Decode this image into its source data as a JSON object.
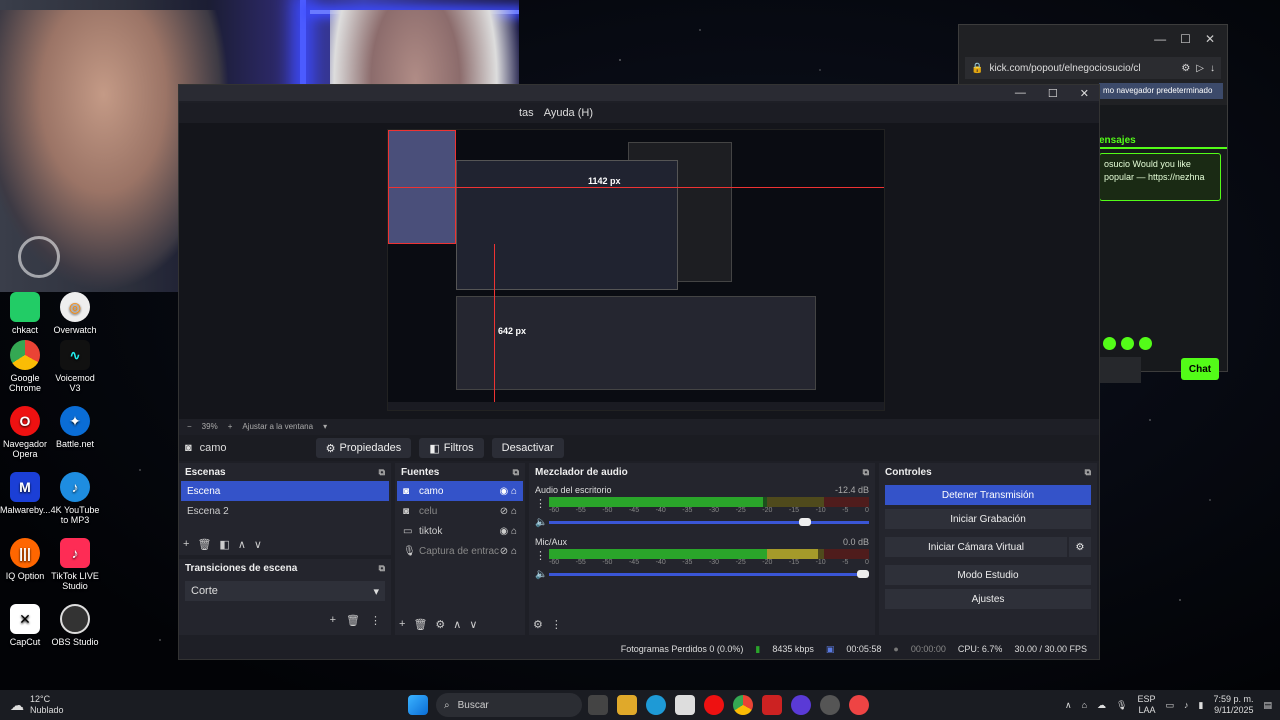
{
  "desktop_icons": [
    {
      "label": "chkact"
    },
    {
      "label": "Overwatch"
    },
    {
      "label": "Google Chrome"
    },
    {
      "label": "Voicemod V3"
    },
    {
      "label": "Navegador Opera"
    },
    {
      "label": "Battle.net"
    },
    {
      "label": "Malwareby..."
    },
    {
      "label": "4K YouTube to MP3"
    },
    {
      "label": "IQ Option"
    },
    {
      "label": "TikTok LIVE Studio"
    },
    {
      "label": "CapCut"
    },
    {
      "label": "OBS Studio"
    }
  ],
  "browser": {
    "url": "kick.com/popout/elnegociosucio/cl",
    "notice": "mo navegador predeterminado",
    "messages_label": "ensajes",
    "message": "osucio Would you like popular — https://nezhna",
    "chat_button": "Chat"
  },
  "obs": {
    "menu": [
      "tas",
      "Ayuda (H)"
    ],
    "preview": {
      "label_h": "1142 px",
      "label_v": "642 px"
    },
    "zoom": {
      "minus": "−",
      "value": "39%",
      "plus": "+",
      "fit": "Ajustar a la ventana"
    },
    "source_bar": {
      "name": "camo",
      "properties": "Propiedades",
      "filters": "Filtros",
      "deactivate": "Desactivar"
    },
    "scenes": {
      "title": "Escenas",
      "items": [
        "Escena",
        "Escena 2"
      ]
    },
    "transitions": {
      "title": "Transiciones de escena",
      "selected": "Corte"
    },
    "sources": {
      "title": "Fuentes",
      "items": [
        "camo",
        "celu",
        "tiktok",
        "Captura de entrac"
      ]
    },
    "mixer": {
      "title": "Mezclador de audio",
      "channels": [
        {
          "name": "Audio del escritorio",
          "db": "-12.4 dB",
          "level": 0.67,
          "volume": 0.82
        },
        {
          "name": "Mic/Aux",
          "db": "0.0 dB",
          "level": 0.84,
          "volume": 1.0
        }
      ],
      "scale": [
        "-60",
        "-55",
        "-50",
        "-45",
        "-40",
        "-35",
        "-30",
        "-25",
        "-20",
        "-15",
        "-10",
        "-5",
        "0"
      ]
    },
    "controls": {
      "title": "Controles",
      "stop_stream": "Detener Transmisión",
      "start_recording": "Iniciar Grabación",
      "virtual_cam": "Iniciar Cámara Virtual",
      "studio_mode": "Modo Estudio",
      "settings": "Ajustes"
    },
    "status": {
      "dropped": "Fotogramas Perdidos 0 (0.0%)",
      "bitrate": "8435 kbps",
      "stream_time": "00:05:58",
      "rec_time": "00:00:00",
      "cpu": "CPU: 6.7%",
      "fps": "30.00 / 30.00 FPS"
    }
  },
  "taskbar": {
    "temp": "12°C",
    "weather": "Nublado",
    "search": "Buscar",
    "lang": "ESP",
    "region": "LAA",
    "time": "7:59 p. m.",
    "date": "9/11/2025"
  },
  "colors": {
    "accent": "#3453c9",
    "kick": "#53fc18",
    "meter_green": "#2aa52a"
  }
}
